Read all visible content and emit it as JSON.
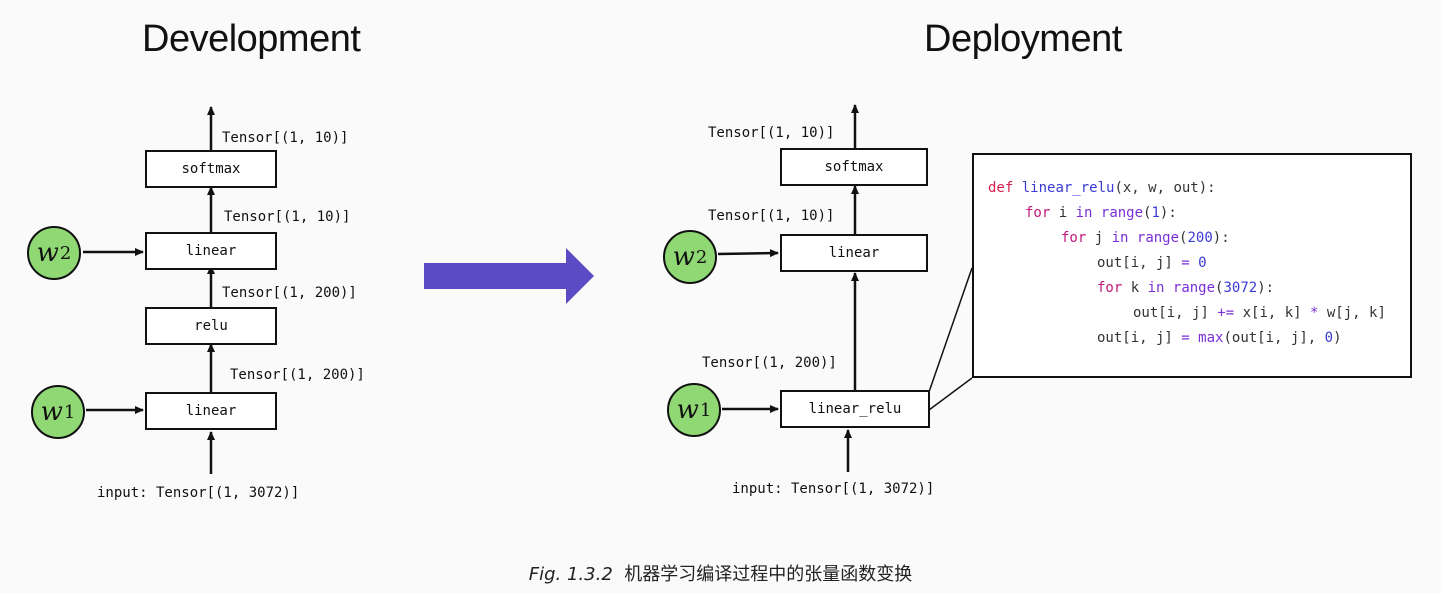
{
  "titles": {
    "left": "Development",
    "right": "Deployment"
  },
  "left": {
    "softmax_out": "Tensor[(1, 10)]",
    "softmax": "softmax",
    "linear2_out": "Tensor[(1, 10)]",
    "linear2": "linear",
    "relu_out": "Tensor[(1, 200)]",
    "relu": "relu",
    "linear1_out": "Tensor[(1, 200)]",
    "linear1": "linear",
    "input": "input: Tensor[(1, 3072)]",
    "w2": "w",
    "w2_sub": "2",
    "w1": "w",
    "w1_sub": "1"
  },
  "right": {
    "softmax_out": "Tensor[(1, 10)]",
    "softmax": "softmax",
    "linear_out": "Tensor[(1, 10)]",
    "linear": "linear",
    "linear_relu_out": "Tensor[(1, 200)]",
    "linear_relu": "linear_relu",
    "input": "input: Tensor[(1, 3072)]",
    "w2": "w",
    "w2_sub": "2",
    "w1": "w",
    "w1_sub": "1"
  },
  "code": {
    "line1": {
      "def": "def",
      "name": "linear_relu",
      "rest": "(x, w, out):"
    },
    "line2": {
      "for": "for",
      "var": " i ",
      "in": "in",
      "range": "range",
      "open": "(",
      "num": "1",
      "close": "):"
    },
    "line3": {
      "for": "for",
      "var": " j ",
      "in": "in",
      "range": "range",
      "open": "(",
      "num": "200",
      "close": "):"
    },
    "line4": {
      "lhs": "out[i, j] ",
      "eq": "=",
      "num": "0"
    },
    "line5": {
      "for": "for",
      "var": " k ",
      "in": "in",
      "range": "range",
      "open": "(",
      "num": "3072",
      "close": "):"
    },
    "line6": {
      "lhs": "out[i, j] ",
      "op": "+=",
      "mid": " x[i, k] ",
      "mul": "*",
      "rhs": " w[j, k]"
    },
    "line7": {
      "lhs": "out[i, j] ",
      "eq": "=",
      "max": "max",
      "args": "(out[i, j], ",
      "num": "0",
      "close": ")"
    }
  },
  "caption": {
    "fig": "Fig. 1.3.2",
    "text": "机器学习编译过程中的张量函数变换"
  },
  "colors": {
    "arrow": "#5b4bc4",
    "circle": "#8fd873"
  }
}
